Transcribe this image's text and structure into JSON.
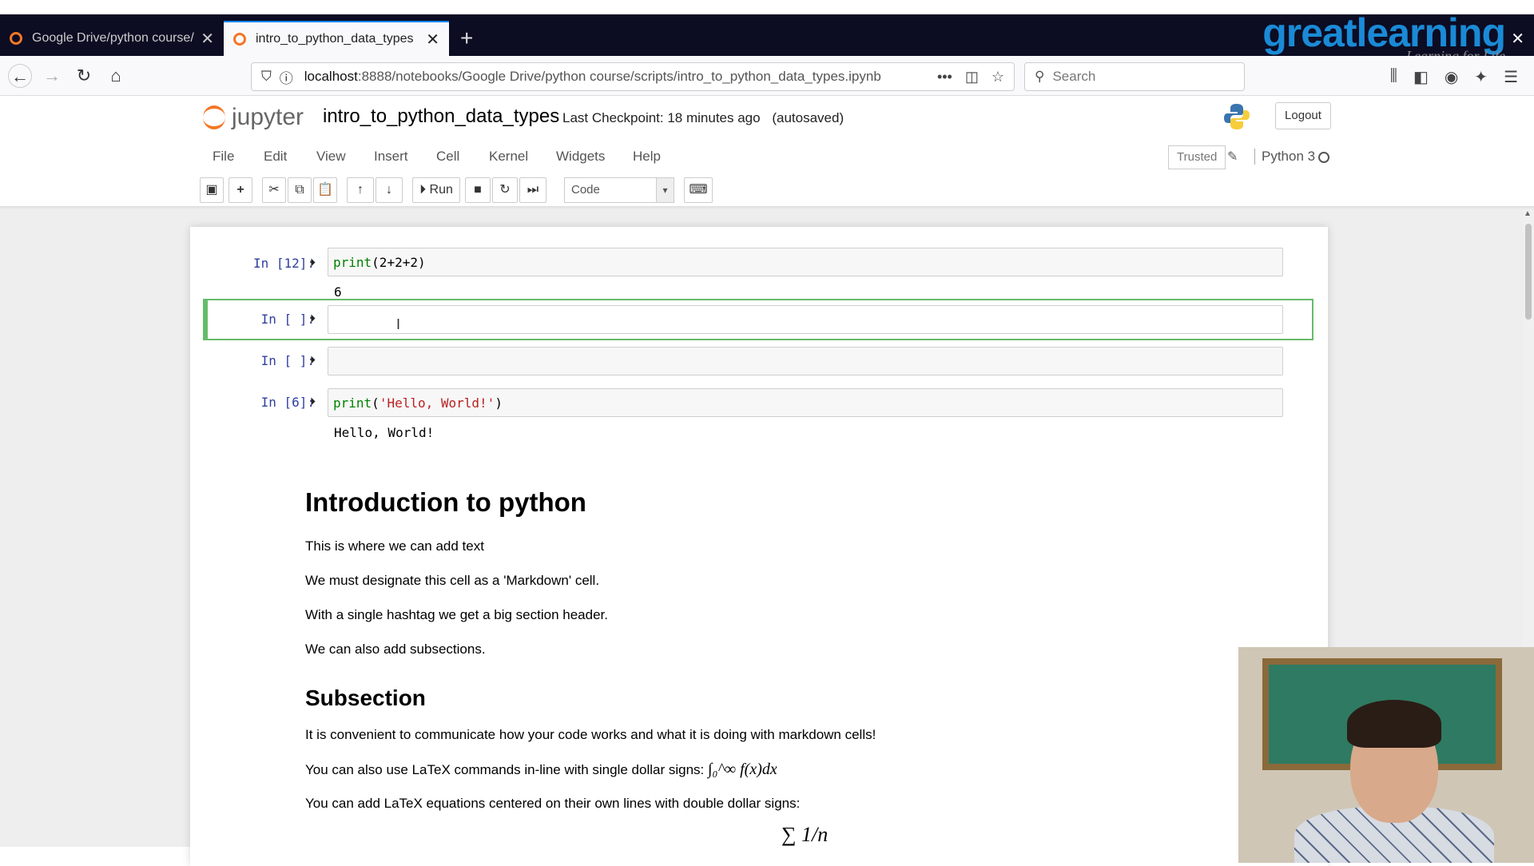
{
  "browser": {
    "tabs": [
      {
        "title": "Google Drive/python course/s",
        "active": false
      },
      {
        "title": "intro_to_python_data_types",
        "active": true
      }
    ],
    "url_host": "localhost",
    "url_rest": ":8888/notebooks/Google Drive/python course/scripts/intro_to_python_data_types.ipynb",
    "search_placeholder": "Search"
  },
  "branding": {
    "logo": "greatlearning",
    "tagline": "Learning for Life"
  },
  "jupyter": {
    "logo_text": "jupyter",
    "notebook_name": "intro_to_python_data_types",
    "checkpoint": "Last Checkpoint: 18 minutes ago",
    "autosaved": "(autosaved)",
    "logout": "Logout",
    "menu": [
      "File",
      "Edit",
      "View",
      "Insert",
      "Cell",
      "Kernel",
      "Widgets",
      "Help"
    ],
    "trusted": "Trusted",
    "kernel": "Python 3",
    "run_label": "Run",
    "cell_type": "Code"
  },
  "cells": [
    {
      "prompt": "In [12]:",
      "code_fn": "print",
      "code_args": "(2+2+2)",
      "output": "6"
    },
    {
      "prompt": "In [ ]:",
      "code": ""
    },
    {
      "prompt": "In [ ]:",
      "code": ""
    },
    {
      "prompt": "In [6]:",
      "code_fn": "print",
      "code_open": "(",
      "code_str": "'Hello, World!'",
      "code_close": ")",
      "output": "Hello, World!"
    }
  ],
  "markdown": {
    "h1": "Introduction to python",
    "p1": "This is where we can add text",
    "p2": "We must designate this cell as a 'Markdown' cell.",
    "p3": "With a single hashtag we get a big section header.",
    "p4": "We can also add subsections.",
    "h2": "Subsection",
    "p5": "It is convenient to communicate how your code works and what it is doing with markdown cells!",
    "p6": "You can also use LaTeX commands in-line with single dollar signs:",
    "p6_math": "∫₀^∞ f(x)dx",
    "p7": "You can add LaTeX equations centered on their own lines with double dollar signs:",
    "p7_math": "∑ 1/n"
  }
}
